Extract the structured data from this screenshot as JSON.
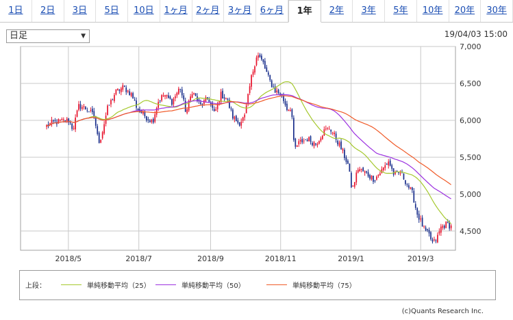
{
  "tabs": [
    "1日",
    "2日",
    "3日",
    "5日",
    "10日",
    "1ヶ月",
    "2ヶ月",
    "3ヶ月",
    "6ヶ月",
    "1年",
    "2年",
    "3年",
    "5年",
    "10年",
    "20年",
    "30年"
  ],
  "active_tab": "1年",
  "select": {
    "value": "日足",
    "caret": "▼"
  },
  "timestamp": "19/04/03 15:00",
  "credit": "(c)Quants Research Inc.",
  "colors": {
    "up": "#e8142d",
    "down": "#1a2f8c",
    "ma25": "#a5c82d",
    "ma50": "#9b30e0",
    "ma75": "#f05a28",
    "grid": "#c8c8c8",
    "frame": "#a0a0a0"
  },
  "chart_data": {
    "type": "candlestick",
    "title": "",
    "xlabel": "",
    "ylabel": "",
    "x_ticks": [
      "2018/5",
      "2018/7",
      "2018/9",
      "2018/11",
      "2019/1",
      "2019/3"
    ],
    "x_tick_positions": [
      0.11,
      0.272,
      0.437,
      0.598,
      0.76,
      0.92
    ],
    "y_ticks": [
      "4,500",
      "5,000",
      "5,500",
      "6,000",
      "6,500",
      "7,000"
    ],
    "y_tick_values": [
      4500,
      5000,
      5500,
      6000,
      6500,
      7000
    ],
    "ylim": [
      4240,
      7000
    ],
    "grid": true,
    "legend_prefix": "上段：",
    "series": [
      {
        "name": "単純移動平均（25）",
        "key": "ma25"
      },
      {
        "name": "単純移動平均（50）",
        "key": "ma50"
      },
      {
        "name": "単純移動平均（75）",
        "key": "ma75"
      }
    ],
    "price_anchors": [
      [
        0.0,
        5920
      ],
      [
        0.015,
        5970
      ],
      [
        0.04,
        5990
      ],
      [
        0.055,
        6000
      ],
      [
        0.065,
        5880
      ],
      [
        0.08,
        6200
      ],
      [
        0.1,
        6150
      ],
      [
        0.118,
        6050
      ],
      [
        0.128,
        5700
      ],
      [
        0.135,
        5780
      ],
      [
        0.15,
        6150
      ],
      [
        0.17,
        6380
      ],
      [
        0.19,
        6450
      ],
      [
        0.21,
        6350
      ],
      [
        0.225,
        6150
      ],
      [
        0.245,
        6050
      ],
      [
        0.262,
        5980
      ],
      [
        0.275,
        6250
      ],
      [
        0.29,
        6350
      ],
      [
        0.31,
        6250
      ],
      [
        0.33,
        6450
      ],
      [
        0.345,
        6100
      ],
      [
        0.36,
        6400
      ],
      [
        0.38,
        6200
      ],
      [
        0.4,
        6300
      ],
      [
        0.415,
        6080
      ],
      [
        0.43,
        6350
      ],
      [
        0.445,
        6300
      ],
      [
        0.46,
        6050
      ],
      [
        0.475,
        5960
      ],
      [
        0.49,
        6050
      ],
      [
        0.505,
        6550
      ],
      [
        0.52,
        6900
      ],
      [
        0.535,
        6780
      ],
      [
        0.55,
        6550
      ],
      [
        0.565,
        6400
      ],
      [
        0.58,
        6350
      ],
      [
        0.595,
        6150
      ],
      [
        0.605,
        6180
      ],
      [
        0.612,
        5600
      ],
      [
        0.625,
        5700
      ],
      [
        0.645,
        5750
      ],
      [
        0.665,
        5680
      ],
      [
        0.685,
        5850
      ],
      [
        0.7,
        5900
      ],
      [
        0.715,
        5760
      ],
      [
        0.73,
        5600
      ],
      [
        0.745,
        5400
      ],
      [
        0.755,
        5050
      ],
      [
        0.77,
        5350
      ],
      [
        0.79,
        5280
      ],
      [
        0.81,
        5200
      ],
      [
        0.83,
        5330
      ],
      [
        0.845,
        5450
      ],
      [
        0.86,
        5250
      ],
      [
        0.875,
        5300
      ],
      [
        0.89,
        5150
      ],
      [
        0.905,
        5000
      ],
      [
        0.915,
        4750
      ],
      [
        0.925,
        4630
      ],
      [
        0.935,
        4500
      ],
      [
        0.945,
        4450
      ],
      [
        0.955,
        4330
      ],
      [
        0.965,
        4400
      ],
      [
        0.975,
        4550
      ],
      [
        0.99,
        4600
      ],
      [
        1.0,
        4560
      ]
    ]
  }
}
